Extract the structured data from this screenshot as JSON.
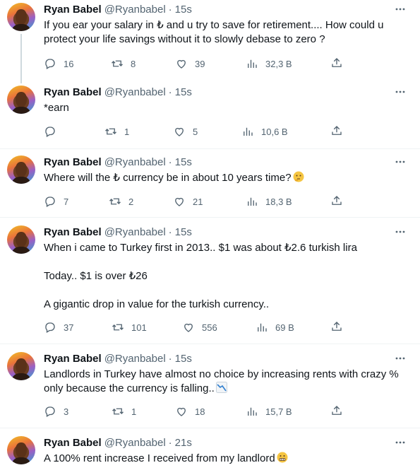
{
  "tweets": [
    {
      "author": "Ryan Babel",
      "handle": "@Ryanbabel",
      "time": "15s",
      "lines": [
        "If you ear your salary in ₺ and u try to save for retirement.... How could u",
        "protect your life savings without it to slowly debase to zero ?"
      ],
      "replies": "16",
      "retweets": "8",
      "likes": "39",
      "views": "32,3 B"
    },
    {
      "author": "Ryan Babel",
      "handle": "@Ryanbabel",
      "time": "15s",
      "lines": [
        "*earn"
      ],
      "replies": "",
      "retweets": "1",
      "likes": "5",
      "views": "10,6 B"
    },
    {
      "author": "Ryan Babel",
      "handle": "@Ryanbabel",
      "time": "15s",
      "lines": [
        "Where will the ₺ currency be in about 10 years time?"
      ],
      "emoji": "thinking-face",
      "replies": "7",
      "retweets": "2",
      "likes": "21",
      "views": "18,3 B"
    },
    {
      "author": "Ryan Babel",
      "handle": "@Ryanbabel",
      "time": "15s",
      "lines": [
        "When i came to Turkey first in 2013.. $1 was about ₺2.6 turkish lira",
        "",
        "Today.. $1 is over ₺26",
        "",
        "A gigantic drop in value for the turkish currency.."
      ],
      "replies": "37",
      "retweets": "101",
      "likes": "556",
      "views": "69 B"
    },
    {
      "author": "Ryan Babel",
      "handle": "@Ryanbabel",
      "time": "15s",
      "lines": [
        "Landlords in Turkey have almost no choice by increasing rents with crazy %",
        "only because the currency is falling.."
      ],
      "emoji": "chart-decreasing",
      "replies": "3",
      "retweets": "1",
      "likes": "18",
      "views": "15,7 B"
    },
    {
      "author": "Ryan Babel",
      "handle": "@Ryanbabel",
      "time": "21s",
      "lines": [
        "A 100% rent increase I received from my landlord"
      ],
      "emoji": "grimacing-face"
    }
  ],
  "separator": "·"
}
